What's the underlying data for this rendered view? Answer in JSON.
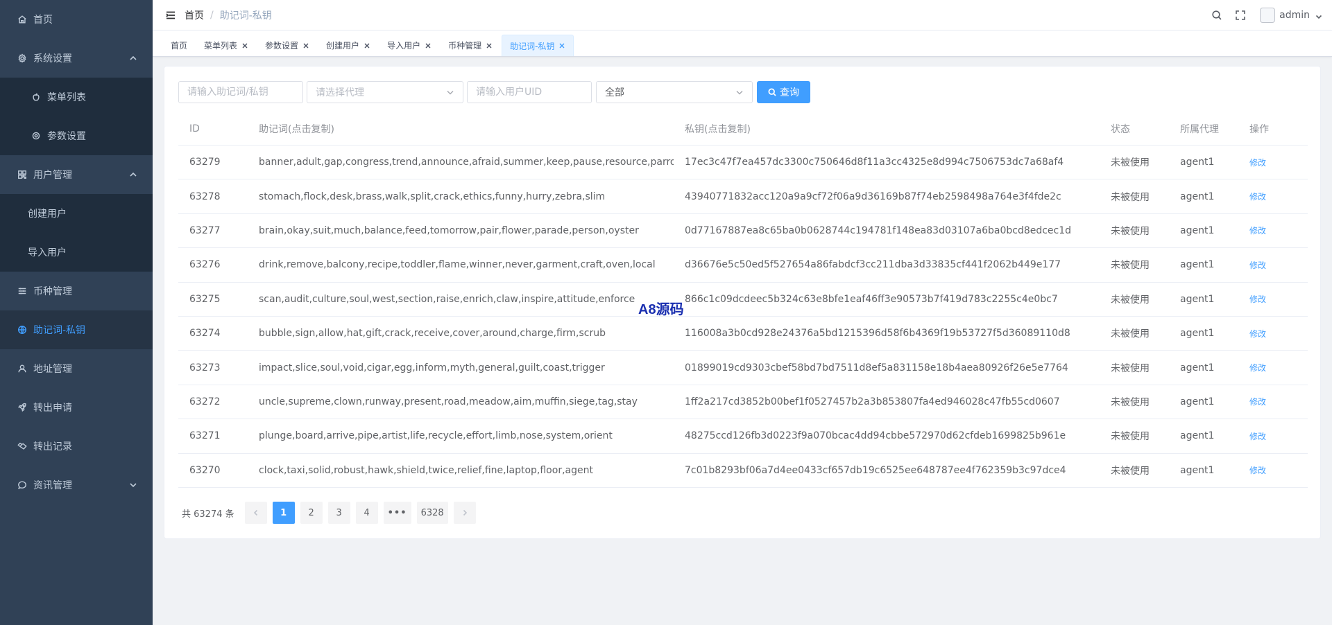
{
  "sidebar": {
    "home": "首页",
    "system_settings": "系统设置",
    "menu_list": "菜单列表",
    "param_settings": "参数设置",
    "user_management": "用户管理",
    "create_user": "创建用户",
    "import_user": "导入用户",
    "currency_management": "币种管理",
    "mnemonic_key": "助记词-私钥",
    "address_management": "地址管理",
    "transfer_request": "转出申请",
    "transfer_record": "转出记录",
    "news_management": "资讯管理"
  },
  "header": {
    "breadcrumb_home": "首页",
    "breadcrumb_sep": "/",
    "breadcrumb_current": "助记词-私钥",
    "username": "admin"
  },
  "tags": [
    "首页",
    "菜单列表",
    "参数设置",
    "创建用户",
    "导入用户",
    "币种管理",
    "助记词-私钥"
  ],
  "filters": {
    "mnemonic_placeholder": "请输入助记词/私钥",
    "agent_placeholder": "请选择代理",
    "uid_placeholder": "请输入用户UID",
    "status_value": "全部",
    "query_label": "查询"
  },
  "table": {
    "headers": {
      "id": "ID",
      "mnemonic": "助记词(点击复制)",
      "private_key": "私钥(点击复制)",
      "status": "状态",
      "agent": "所属代理",
      "action": "操作"
    },
    "rows": [
      {
        "id": "63279",
        "mnemonic": "banner,adult,gap,congress,trend,announce,afraid,summer,keep,pause,resource,parrot",
        "key": "17ec3c47f7ea457dc3300c750646d8f11a3cc4325e8d994c7506753dc7a68af4",
        "status": "未被使用",
        "agent": "agent1",
        "action": "修改"
      },
      {
        "id": "63278",
        "mnemonic": "stomach,flock,desk,brass,walk,split,crack,ethics,funny,hurry,zebra,slim",
        "key": "43940771832acc120a9a9cf72f06a9d36169b87f74eb2598498a764e3f4fde2c",
        "status": "未被使用",
        "agent": "agent1",
        "action": "修改"
      },
      {
        "id": "63277",
        "mnemonic": "brain,okay,suit,much,balance,feed,tomorrow,pair,flower,parade,person,oyster",
        "key": "0d77167887ea8c65ba0b0628744c194781f148ea83d03107a6ba0bcd8edcec1d",
        "status": "未被使用",
        "agent": "agent1",
        "action": "修改"
      },
      {
        "id": "63276",
        "mnemonic": "drink,remove,balcony,recipe,toddler,flame,winner,never,garment,craft,oven,local",
        "key": "d36676e5c50ed5f527654a86fabdcf3cc211dba3d33835cf441f2062b449e177",
        "status": "未被使用",
        "agent": "agent1",
        "action": "修改"
      },
      {
        "id": "63275",
        "mnemonic": "scan,audit,culture,soul,west,section,raise,enrich,claw,inspire,attitude,enforce",
        "key": "866c1c09dcdeec5b324c63e8bfe1eaf46ff3e90573b7f419d783c2255c4e0bc7",
        "status": "未被使用",
        "agent": "agent1",
        "action": "修改"
      },
      {
        "id": "63274",
        "mnemonic": "bubble,sign,allow,hat,gift,crack,receive,cover,around,charge,firm,scrub",
        "key": "116008a3b0cd928e24376a5bd1215396d58f6b4369f19b53727f5d36089110d8",
        "status": "未被使用",
        "agent": "agent1",
        "action": "修改"
      },
      {
        "id": "63273",
        "mnemonic": "impact,slice,soul,void,cigar,egg,inform,myth,general,guilt,coast,trigger",
        "key": "01899019cd9303cbef58bd7bd7511d8ef5a831158e18b4aea80926f26e5e7764",
        "status": "未被使用",
        "agent": "agent1",
        "action": "修改"
      },
      {
        "id": "63272",
        "mnemonic": "uncle,supreme,clown,runway,present,road,meadow,aim,muffin,siege,tag,stay",
        "key": "1ff2a217cd3852b00bef1f0527457b2a3b853807fa4ed946028c47fb55cd0607",
        "status": "未被使用",
        "agent": "agent1",
        "action": "修改"
      },
      {
        "id": "63271",
        "mnemonic": "plunge,board,arrive,pipe,artist,life,recycle,effort,limb,nose,system,orient",
        "key": "48275ccd126fb3d0223f9a070bcac4dd94cbbe572970d62cfdeb1699825b961e",
        "status": "未被使用",
        "agent": "agent1",
        "action": "修改"
      },
      {
        "id": "63270",
        "mnemonic": "clock,taxi,solid,robust,hawk,shield,twice,relief,fine,laptop,floor,agent",
        "key": "7c01b8293bf06a7d4ee0433cf657db19c6525ee648787ee4f762359b3c97dce4",
        "status": "未被使用",
        "agent": "agent1",
        "action": "修改"
      }
    ]
  },
  "pagination": {
    "total_text": "共 63274 条",
    "pages": [
      "1",
      "2",
      "3",
      "4"
    ],
    "more": "•••",
    "last": "6328",
    "current": "1"
  },
  "watermark": "A8源码",
  "colors": {
    "sidebar_bg": "#304156",
    "accent": "#409eff",
    "active_text": "#409eff"
  }
}
